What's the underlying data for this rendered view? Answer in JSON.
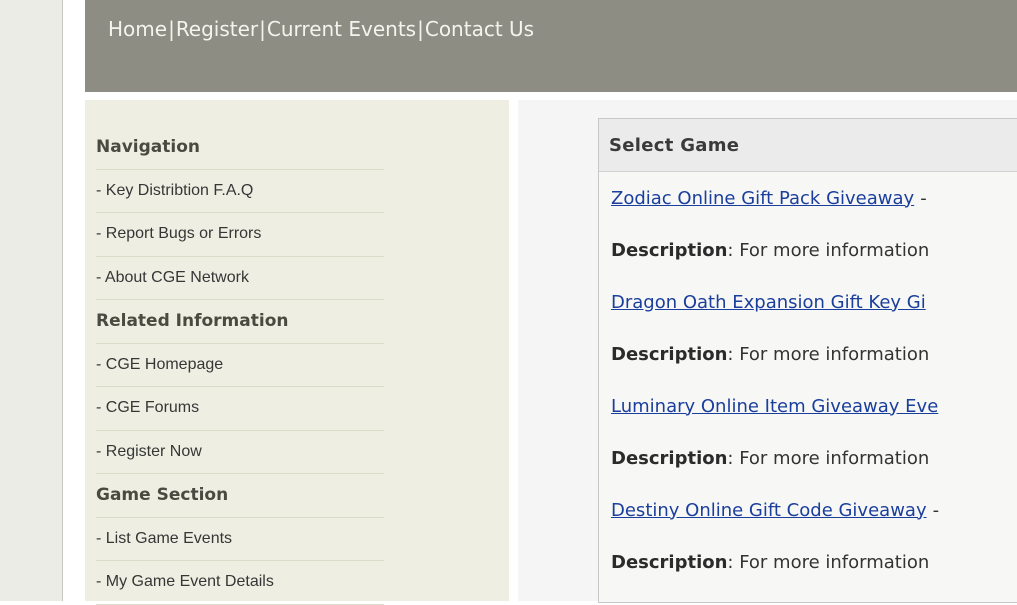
{
  "topnav": {
    "items": [
      "Home",
      "Register",
      "Current Events",
      "Contact Us"
    ],
    "separator": "|"
  },
  "sidebar": {
    "items": [
      {
        "label": "Navigation",
        "type": "heading"
      },
      {
        "label": "- Key Distribtion F.A.Q",
        "type": "link"
      },
      {
        "label": "- Report Bugs or Errors",
        "type": "link"
      },
      {
        "label": "- About CGE Network",
        "type": "link"
      },
      {
        "label": "Related Information",
        "type": "heading"
      },
      {
        "label": "- CGE Homepage",
        "type": "link"
      },
      {
        "label": "- CGE Forums",
        "type": "link"
      },
      {
        "label": "- Register Now",
        "type": "link"
      },
      {
        "label": "Game Section",
        "type": "heading"
      },
      {
        "label": "- List Game Events",
        "type": "link"
      },
      {
        "label": "- My Game Event Details",
        "type": "link"
      }
    ]
  },
  "main": {
    "panel_title": "Select Game",
    "events": [
      {
        "title": "Zodiac Online Gift Pack Giveaway",
        "suffix": "-",
        "desc_label": "Description",
        "desc_text": ": For more information"
      },
      {
        "title": "Dragon Oath Expansion Gift Key Gi",
        "suffix": "",
        "desc_label": "Description",
        "desc_text": ": For more information"
      },
      {
        "title": "Luminary Online Item Giveaway Eve",
        "suffix": "",
        "desc_label": "Description",
        "desc_text": ": For more information"
      },
      {
        "title": "Destiny Online Gift Code Giveaway",
        "suffix": "-",
        "desc_label": "Description",
        "desc_text": ": For more information"
      }
    ]
  },
  "colors": {
    "header_bg": "#8d8d83",
    "sidebar_bg": "#eeefe2",
    "link": "#1a3e9c"
  }
}
